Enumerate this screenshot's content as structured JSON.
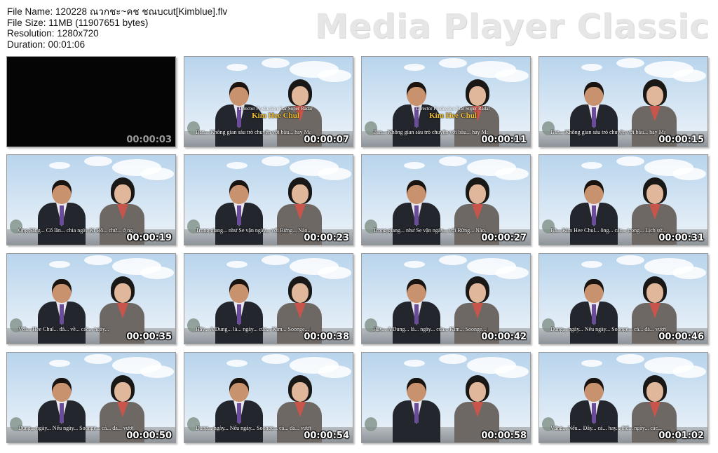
{
  "info": {
    "file_name": "File Name: 120228 ณวกชะ~คช ชณบcut[Kimblue].flv",
    "file_size": "File Size: 11MB (11907651 bytes)",
    "resolution": "Resolution: 1280x720",
    "duration": "Duration: 00:01:06"
  },
  "brand": "Media Player Classic",
  "caption": {
    "small": "Director Production Star Super Radar",
    "name": "Kim Hee Chul"
  },
  "thumbnails": [
    {
      "time": "00:00:03",
      "subtitle": ""
    },
    {
      "time": "00:00:07",
      "subtitle": "Ban... Không gian sáu trò chuyện với bầu... hay Mac kia sau ngày sáo... Vui mừng... trong các chúa tiếng..."
    },
    {
      "time": "00:00:11",
      "subtitle": "Ban... Không gian sáu trò chuyện với bầu... hay Mac kia sau ngày sáo... Vui mừng... trong các chúa tiếng..."
    },
    {
      "time": "00:00:15",
      "subtitle": "Ban... Không gian sáu trò chuyện với bầu... hay Mac kia sau ngày sáo... Vui mừng... trong các chúa tiếng..."
    },
    {
      "time": "00:00:19",
      "subtitle": "Ông Sáng... Cố lần... chia ngày Ki Bồ... chứ... ở ngày... Đầu sáo thể... Nay cả... quần... trong và... điên..."
    },
    {
      "time": "00:00:23",
      "subtitle": "Trong giang... như Se vận ngày... với Rừng... Nào... Hồng chị dẫn lý... thông... các ngày Song chọn..."
    },
    {
      "time": "00:00:27",
      "subtitle": "Trong giang... như Se vận ngày... với Rừng... Nào... Hồng chị dẫn lý... thông... các ngày Song chọn..."
    },
    {
      "time": "00:00:31",
      "subtitle": "Bà... Kim Hee Chul... ông... các... trong... Lịch sử... các... thể... người... gặp..."
    },
    {
      "time": "00:00:35",
      "subtitle": "Với... Hee Chul... đã... về... các... ngày..."
    },
    {
      "time": "00:00:38",
      "subtitle": "Hãy... A Dung... là... ngày... của... Kim... Soonge... Ông... Hee... Song... vậy..."
    },
    {
      "time": "00:00:42",
      "subtitle": "Hãy... A Dung... là... ngày... của... Kim... Soonge... Ông... Hee... Song... vậy..."
    },
    {
      "time": "00:00:46",
      "subtitle": "Dung... ngày... Nếu ngày... Soonge... cả... đã... vượt... thời... làm..."
    },
    {
      "time": "00:00:50",
      "subtitle": "Dung... ngày... Nếu ngày... Soonge... cả... đã... vượt... thời... làm..."
    },
    {
      "time": "00:00:54",
      "subtitle": "Dung... ngày... Nếu ngày... Soonge... cả... đã... vượt... thời... làm..."
    },
    {
      "time": "00:00:58",
      "subtitle": ""
    },
    {
      "time": "00:01:02",
      "subtitle": "Vâng... Nếu... Đây... cả... hay... thể... ngày... các..."
    }
  ]
}
